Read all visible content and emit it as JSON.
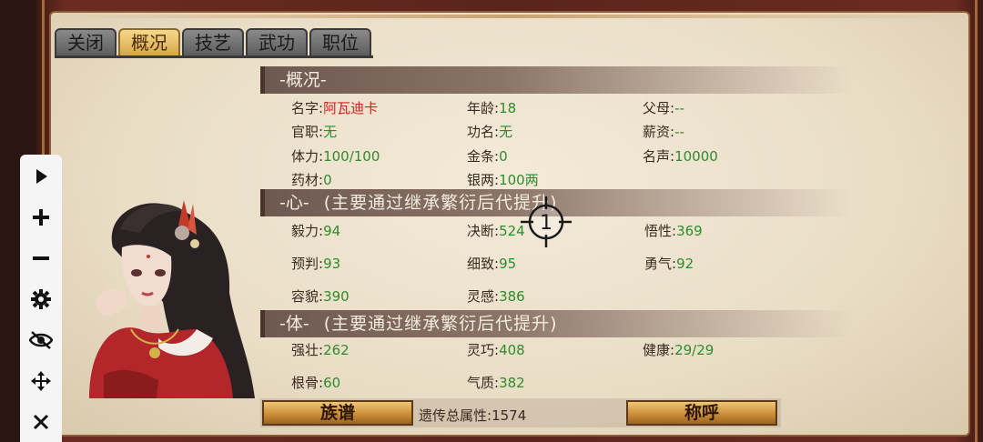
{
  "tabs": [
    {
      "label": "关闭",
      "active": false
    },
    {
      "label": "概况",
      "active": true
    },
    {
      "label": "技艺",
      "active": false
    },
    {
      "label": "武功",
      "active": false
    },
    {
      "label": "职位",
      "active": false
    }
  ],
  "overview": {
    "header": "-概况-",
    "name_label": "名字:",
    "name_value": "阿瓦迪卡",
    "age_label": "年龄:",
    "age_value": "18",
    "parents_label": "父母:",
    "parents_value": "--",
    "office_label": "官职:",
    "office_value": "无",
    "fame_title_label": "功名:",
    "fame_title_value": "无",
    "salary_label": "薪资:",
    "salary_value": "--",
    "stamina_label": "体力:",
    "stamina_value": "100/100",
    "gold_label": "金条:",
    "gold_value": "0",
    "reputation_label": "名声:",
    "reputation_value": "10000",
    "herbs_label": "药材:",
    "herbs_value": "0",
    "silver_label": "银两:",
    "silver_value": "100两"
  },
  "heart": {
    "header": "-心-",
    "note": "(主要通过继承繁衍后代提升)",
    "perseverance_label": "毅力:",
    "perseverance_value": "94",
    "decision_label": "决断:",
    "decision_value": "524",
    "insight_label": "悟性:",
    "insight_value": "369",
    "foresight_label": "预判:",
    "foresight_value": "93",
    "delicacy_label": "细致:",
    "delicacy_value": "95",
    "courage_label": "勇气:",
    "courage_value": "92",
    "looks_label": "容貌:",
    "looks_value": "390",
    "inspiration_label": "灵感:",
    "inspiration_value": "386"
  },
  "body_section": {
    "header": "-体-",
    "note": "(主要通过继承繁衍后代提升)",
    "strength_label": "强壮:",
    "strength_value": "262",
    "agility_label": "灵巧:",
    "agility_value": "408",
    "health_label": "健康:",
    "health_value": "29/29",
    "constitution_label": "根骨:",
    "constitution_value": "60",
    "temperament_label": "气质:",
    "temperament_value": "382"
  },
  "bottom": {
    "genealogy_button": "族谱",
    "inherit_total_label": "遗传总属性:",
    "inherit_total_value": "1574",
    "title_button": "称呼"
  },
  "crosshair_label": "1",
  "toolbar": [
    "play-icon",
    "plus-icon",
    "minus-icon",
    "gear-icon",
    "eye-off-icon",
    "move-icon",
    "close-icon"
  ]
}
